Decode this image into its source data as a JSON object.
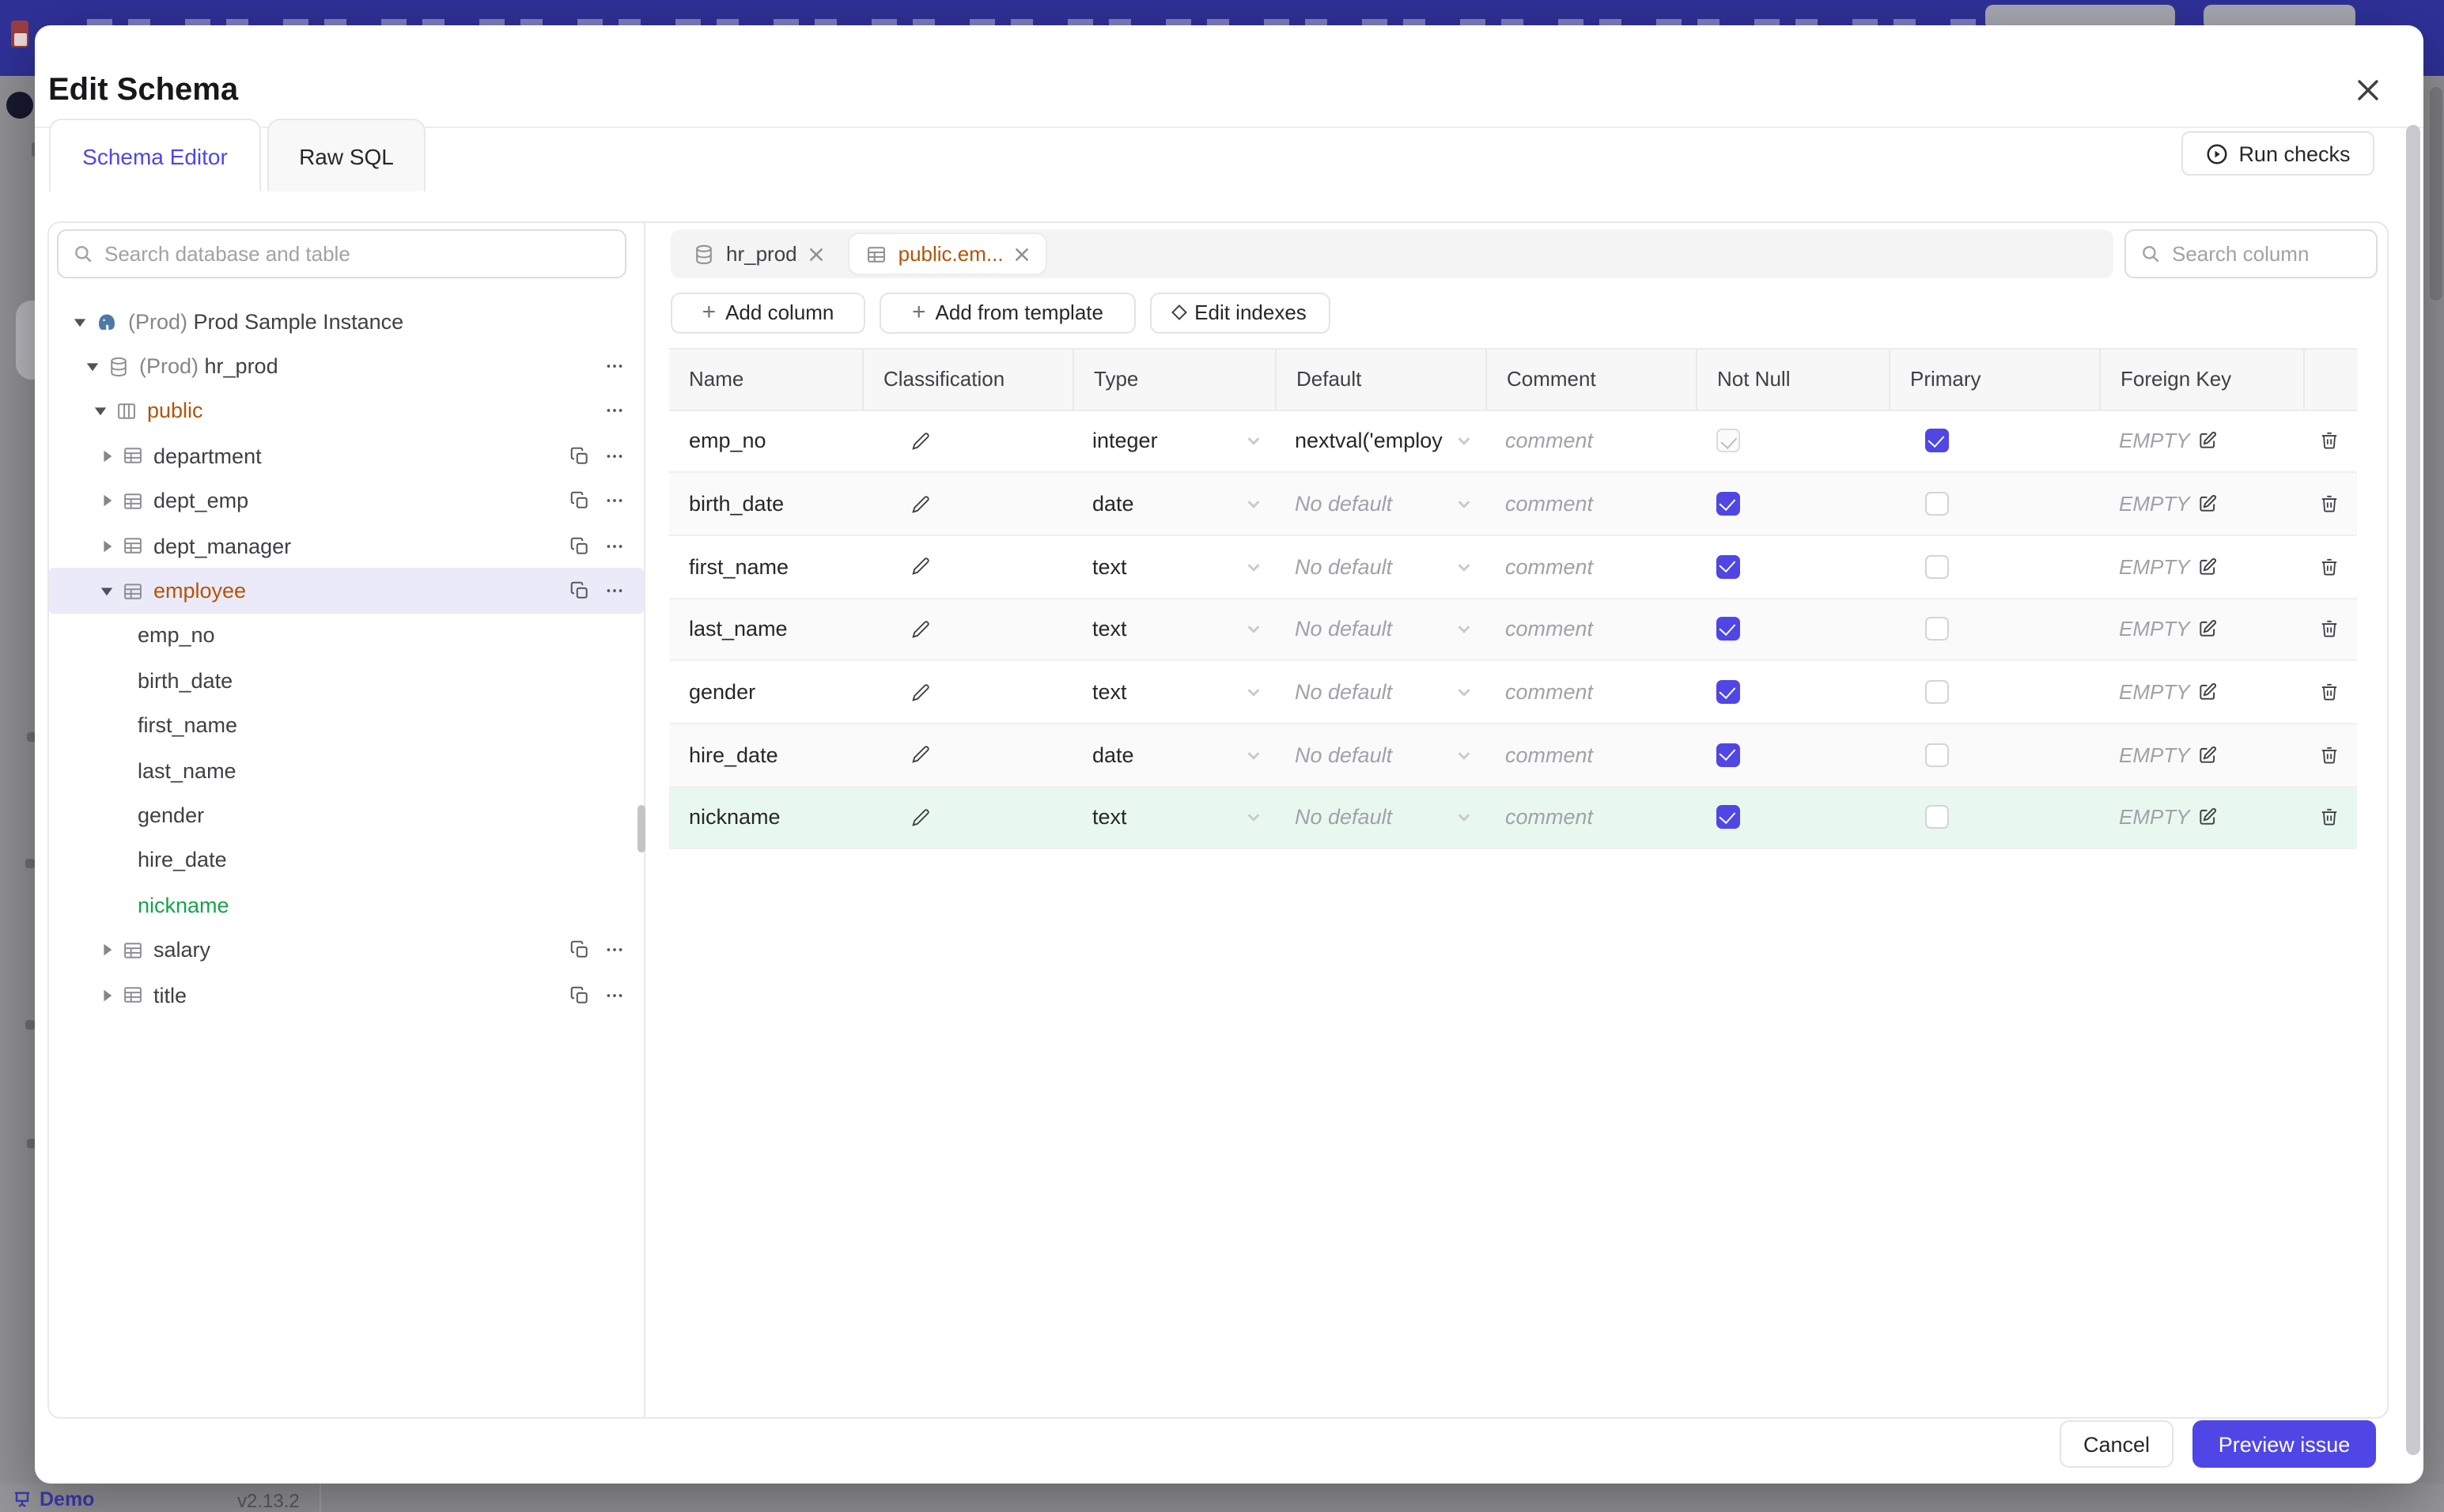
{
  "background": {
    "footer": {
      "app": "Demo",
      "version": "v2.13.2"
    }
  },
  "modal": {
    "title": "Edit Schema",
    "tabs": {
      "schema_editor": "Schema Editor",
      "raw_sql": "Raw SQL"
    },
    "run_checks_label": "Run checks",
    "sidebar": {
      "search_placeholder": "Search database and table",
      "tree": [
        {
          "kind": "instance",
          "level": 0,
          "prefix": "(Prod)",
          "name": "Prod Sample Instance",
          "icon": "postgres",
          "caret": "down"
        },
        {
          "kind": "database",
          "level": 1,
          "prefix": "(Prod)",
          "name": "hr_prod",
          "icon": "database",
          "caret": "down",
          "more": true
        },
        {
          "kind": "schema",
          "level": 2,
          "name": "public",
          "icon": "schema",
          "caret": "down",
          "more": true,
          "color": "amber"
        },
        {
          "kind": "table",
          "level": 3,
          "name": "department",
          "icon": "table",
          "caret": "right",
          "copy": true,
          "more": true
        },
        {
          "kind": "table",
          "level": 3,
          "name": "dept_emp",
          "icon": "table",
          "caret": "right",
          "copy": true,
          "more": true
        },
        {
          "kind": "table",
          "level": 3,
          "name": "dept_manager",
          "icon": "table",
          "caret": "right",
          "copy": true,
          "more": true
        },
        {
          "kind": "table",
          "level": 3,
          "name": "employee",
          "icon": "table",
          "caret": "down",
          "copy": true,
          "more": true,
          "color": "amber",
          "selected": true
        },
        {
          "kind": "column",
          "name": "emp_no"
        },
        {
          "kind": "column",
          "name": "birth_date"
        },
        {
          "kind": "column",
          "name": "first_name"
        },
        {
          "kind": "column",
          "name": "last_name"
        },
        {
          "kind": "column",
          "name": "gender"
        },
        {
          "kind": "column",
          "name": "hire_date"
        },
        {
          "kind": "column",
          "name": "nickname",
          "color": "green"
        },
        {
          "kind": "table",
          "level": 3,
          "name": "salary",
          "icon": "table",
          "caret": "right",
          "copy": true,
          "more": true
        },
        {
          "kind": "table",
          "level": 3,
          "name": "title",
          "icon": "table",
          "caret": "right",
          "copy": true,
          "more": true
        }
      ]
    },
    "editor": {
      "chips": [
        {
          "label": "hr_prod",
          "icon": "database",
          "active": false
        },
        {
          "label": "public.em...",
          "icon": "table",
          "active": true
        }
      ],
      "column_search_placeholder": "Search column",
      "actions": {
        "add_column": "Add column",
        "add_from_template": "Add from template",
        "edit_indexes": "Edit indexes"
      },
      "table": {
        "headers": [
          "Name",
          "Classification",
          "Type",
          "Default",
          "Comment",
          "Not Null",
          "Primary",
          "Foreign Key",
          ""
        ],
        "comment_placeholder": "comment",
        "fk_empty": "EMPTY",
        "no_default": "No default",
        "rows": [
          {
            "name": "emp_no",
            "type": "integer",
            "default_value": "nextval('employ",
            "not_null": true,
            "not_null_disabled": true,
            "primary": true,
            "state": "plain"
          },
          {
            "name": "birth_date",
            "type": "date",
            "not_null": true,
            "primary": false,
            "state": "stripe"
          },
          {
            "name": "first_name",
            "type": "text",
            "not_null": true,
            "primary": false,
            "state": "plain"
          },
          {
            "name": "last_name",
            "type": "text",
            "not_null": true,
            "primary": false,
            "state": "stripe"
          },
          {
            "name": "gender",
            "type": "text",
            "not_null": true,
            "primary": false,
            "state": "plain"
          },
          {
            "name": "hire_date",
            "type": "date",
            "not_null": true,
            "primary": false,
            "state": "stripe"
          },
          {
            "name": "nickname",
            "type": "text",
            "not_null": true,
            "primary": false,
            "state": "new"
          }
        ]
      }
    },
    "footer": {
      "cancel": "Cancel",
      "primary": "Preview issue"
    }
  },
  "colors": {
    "accent": "#4f46e5",
    "amber": "#b45309",
    "green": "#16a34a",
    "new_row_bg": "#e9f8ef",
    "selected_tree_bg": "#eaeaf9",
    "header_band": "#2f3198"
  }
}
